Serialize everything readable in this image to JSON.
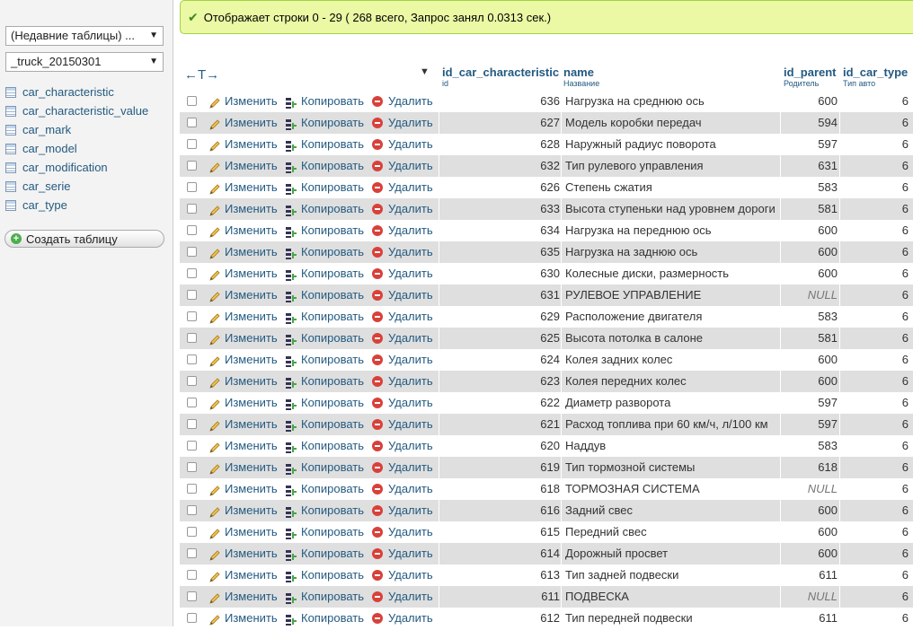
{
  "sidebar": {
    "recent_tables": "(Недавние таблицы) ...",
    "database": "_truck_20150301",
    "tables": [
      "car_characteristic",
      "car_characteristic_value",
      "car_mark",
      "car_model",
      "car_modification",
      "car_serie",
      "car_type"
    ],
    "create_table": "Создать таблицу"
  },
  "message": "Отображает строки 0 - 29 ( 268 всего, Запрос занял 0.0313 сек.)",
  "grid": {
    "sort_arrows": "←T→",
    "columns": [
      {
        "name": "id_car_characteristic",
        "comment": "id"
      },
      {
        "name": "name",
        "comment": "Название"
      },
      {
        "name": "id_parent",
        "comment": "Родитель"
      },
      {
        "name": "id_car_type",
        "comment": "Тип авто"
      }
    ],
    "actions": {
      "edit": "Изменить",
      "copy": "Копировать",
      "delete": "Удалить"
    },
    "rows": [
      {
        "id": "636",
        "name": "Нагрузка на среднюю ось",
        "parent": "600",
        "type": "6"
      },
      {
        "id": "627",
        "name": "Модель коробки передач",
        "parent": "594",
        "type": "6"
      },
      {
        "id": "628",
        "name": "Наружный радиус поворота",
        "parent": "597",
        "type": "6"
      },
      {
        "id": "632",
        "name": "Тип рулевого управления",
        "parent": "631",
        "type": "6"
      },
      {
        "id": "626",
        "name": "Степень сжатия",
        "parent": "583",
        "type": "6"
      },
      {
        "id": "633",
        "name": "Высота ступеньки над уровнем дороги",
        "parent": "581",
        "type": "6"
      },
      {
        "id": "634",
        "name": "Нагрузка на переднюю ось",
        "parent": "600",
        "type": "6"
      },
      {
        "id": "635",
        "name": "Нагрузка на заднюю ось",
        "parent": "600",
        "type": "6"
      },
      {
        "id": "630",
        "name": "Колесные диски, размерность",
        "parent": "600",
        "type": "6"
      },
      {
        "id": "631",
        "name": "РУЛЕВОЕ УПРАВЛЕНИЕ",
        "parent": "NULL",
        "type": "6"
      },
      {
        "id": "629",
        "name": "Расположение двигателя",
        "parent": "583",
        "type": "6"
      },
      {
        "id": "625",
        "name": "Высота потолка в салоне",
        "parent": "581",
        "type": "6"
      },
      {
        "id": "624",
        "name": "Колея задних колес",
        "parent": "600",
        "type": "6"
      },
      {
        "id": "623",
        "name": "Колея передних колес",
        "parent": "600",
        "type": "6"
      },
      {
        "id": "622",
        "name": "Диаметр разворота",
        "parent": "597",
        "type": "6"
      },
      {
        "id": "621",
        "name": "Расход топлива при 60 км/ч, л/100 км",
        "parent": "597",
        "type": "6"
      },
      {
        "id": "620",
        "name": "Наддув",
        "parent": "583",
        "type": "6"
      },
      {
        "id": "619",
        "name": "Тип тормозной системы",
        "parent": "618",
        "type": "6"
      },
      {
        "id": "618",
        "name": "ТОРМОЗНАЯ СИСТЕМА",
        "parent": "NULL",
        "type": "6"
      },
      {
        "id": "616",
        "name": "Задний свес",
        "parent": "600",
        "type": "6"
      },
      {
        "id": "615",
        "name": "Передний свес",
        "parent": "600",
        "type": "6"
      },
      {
        "id": "614",
        "name": "Дорожный просвет",
        "parent": "600",
        "type": "6"
      },
      {
        "id": "613",
        "name": "Тип задней подвески",
        "parent": "611",
        "type": "6"
      },
      {
        "id": "611",
        "name": "ПОДВЕСКА",
        "parent": "NULL",
        "type": "6"
      },
      {
        "id": "612",
        "name": "Тип передней подвески",
        "parent": "611",
        "type": "6"
      }
    ]
  }
}
